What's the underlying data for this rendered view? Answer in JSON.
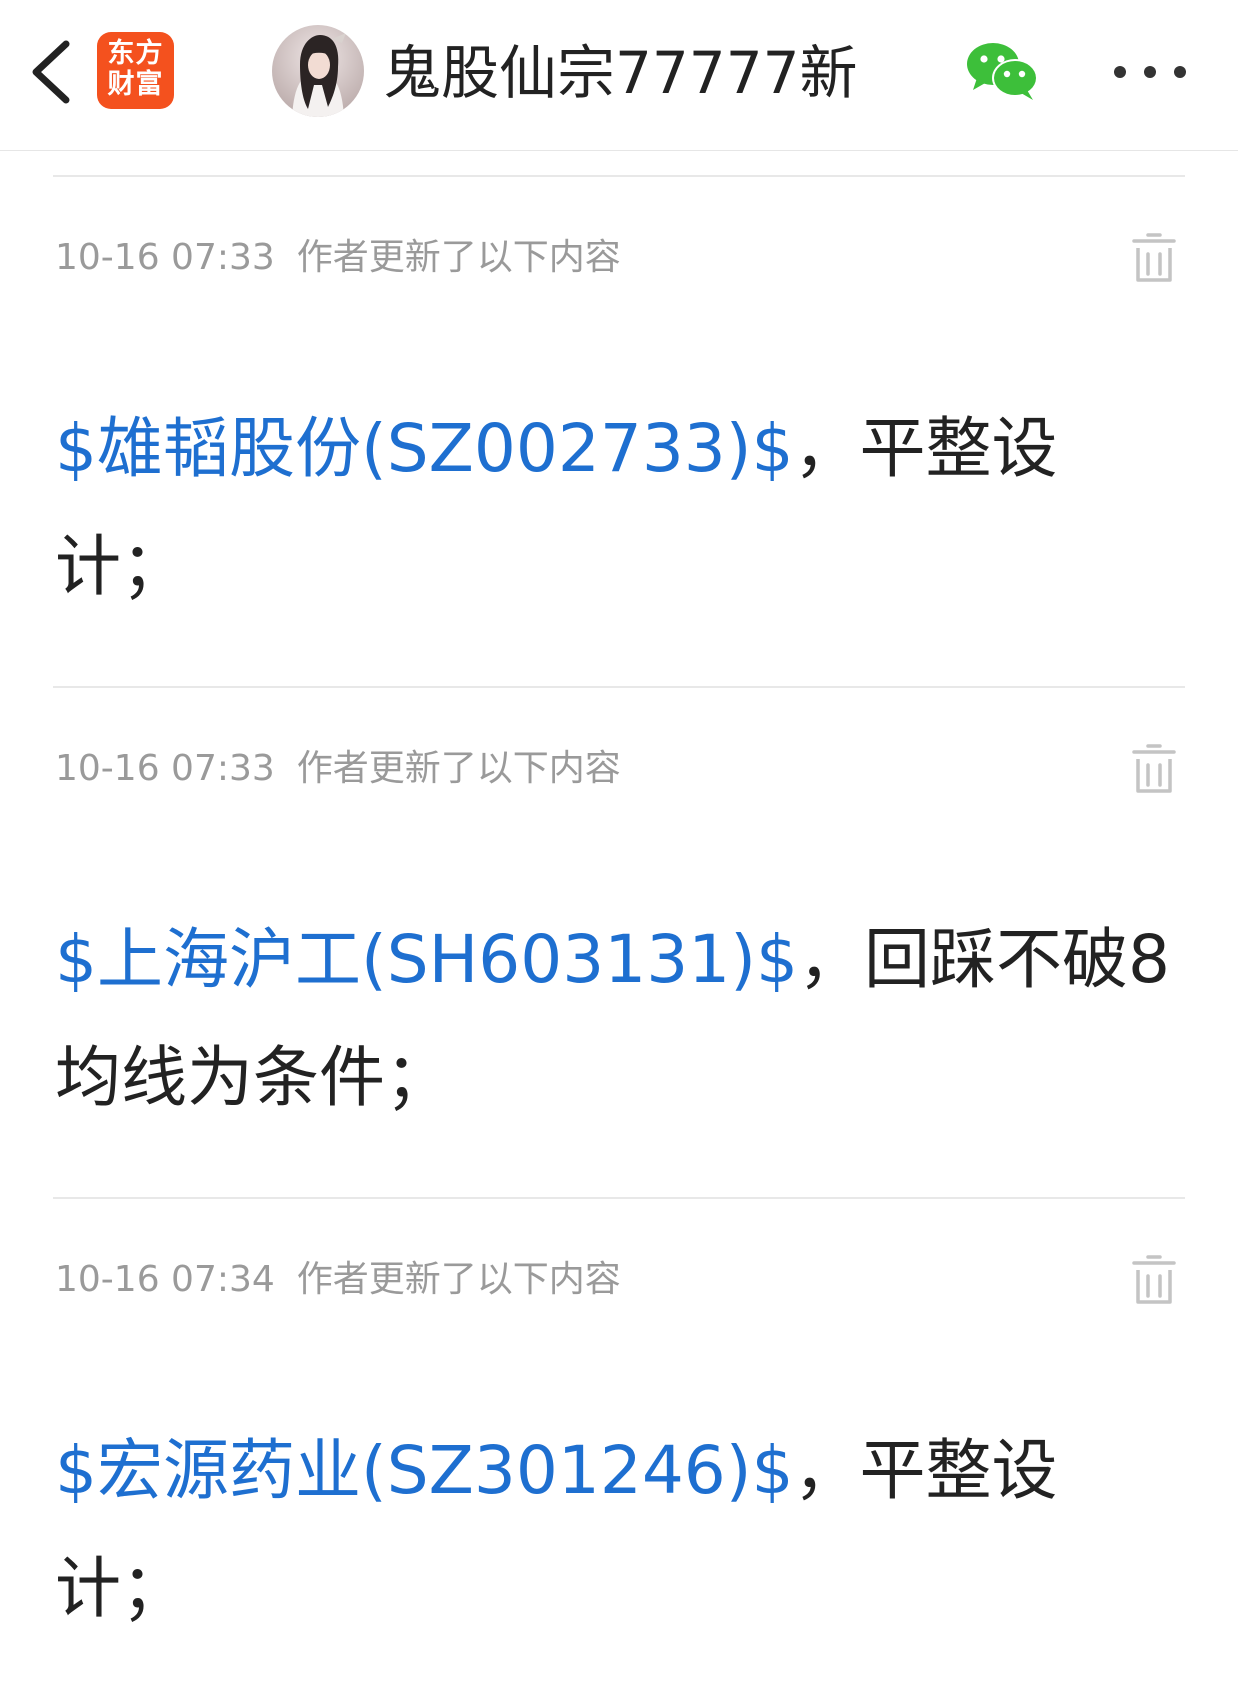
{
  "header": {
    "back_icon": "chevron-left-icon",
    "logo_line1": "东方",
    "logo_line2": "财富",
    "logo_color": "#f4511e",
    "title": "鬼股仙宗77777新",
    "wechat_icon": "wechat-icon",
    "wechat_color": "#3dbf3a",
    "more_icon": "more-dots-icon"
  },
  "colors": {
    "link": "#1e6fd0",
    "text": "#222222",
    "meta": "#9a9a9a"
  },
  "updates": [
    {
      "time": "10-16 07:33",
      "label": "作者更新了以下内容",
      "stock": "$雄韬股份(SZ002733)$",
      "text": "，平整设计；"
    },
    {
      "time": "10-16 07:33",
      "label": "作者更新了以下内容",
      "stock": "$上海沪工(SH603131)$",
      "text": "，回踩不破8均线为条件；"
    },
    {
      "time": "10-16 07:34",
      "label": "作者更新了以下内容",
      "stock": "$宏源药业(SZ301246)$",
      "text": "，平整设计；"
    }
  ]
}
